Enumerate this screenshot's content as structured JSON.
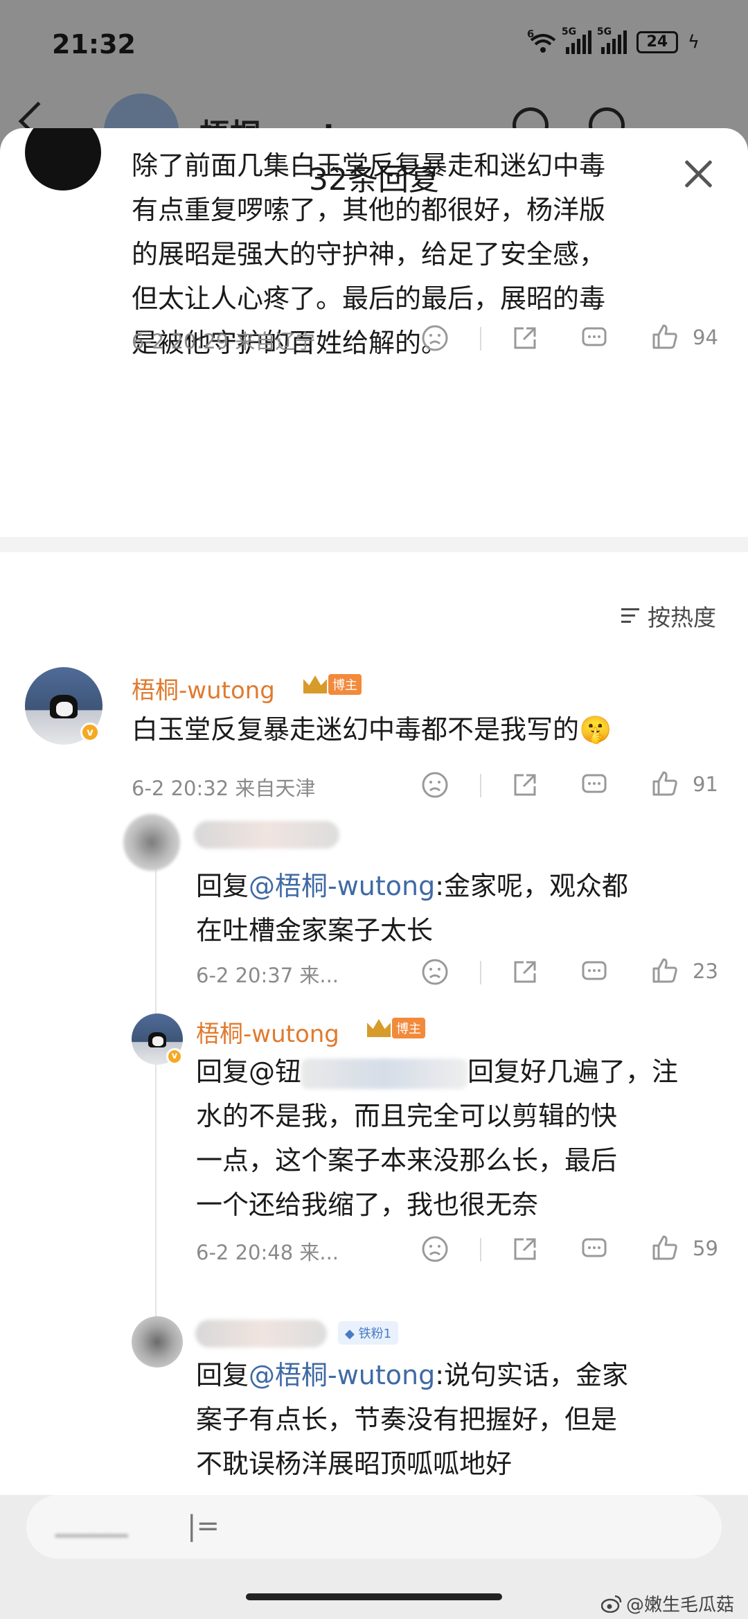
{
  "status_bar": {
    "time": "21:32",
    "wifi_label": "6",
    "net1": "5G",
    "net2": "5G",
    "battery": "24"
  },
  "background_header": {
    "name": "梧桐-wutong"
  },
  "sheet": {
    "title": "32条回复"
  },
  "root_comment": {
    "text": "除了前面几集白玉堂反复暴走和迷幻中毒\n有点重复啰嗦了，其他的都很好，杨洋版\n的展昭是强大的守护神，给足了安全感，\n但太让人心疼了。最后的最后，展昭的毒\n是被他守护的百姓给解的。",
    "meta": "6-2 20:29 来自辽宁",
    "likes": "94"
  },
  "sort": {
    "label": "按热度"
  },
  "replies": [
    {
      "name": "梧桐-wutong",
      "badge": "博主",
      "text": "白玉堂反复暴走迷幻中毒都不是我写的🤫",
      "meta": "6-2 20:32 来自天津",
      "likes": "91"
    },
    {
      "reply_prefix": "回复",
      "mention": "@梧桐-wutong",
      "text_after": ":金家呢，观众都\n在吐槽金家案子太长",
      "meta": "6-2 20:37 来...",
      "likes": "23"
    },
    {
      "name": "梧桐-wutong",
      "badge": "博主",
      "reply_prefix": "回复@钮",
      "text_after": "回复好几遍了，注",
      "text_rest": "水的不是我，而且完全可以剪辑的快\n一点，这个案子本来没那么长，最后\n一个还给我缩了，我也很无奈",
      "meta": "6-2 20:48 来...",
      "likes": "59"
    },
    {
      "fan_badge": "铁粉1",
      "reply_prefix": "回复",
      "mention": "@梧桐-wutong",
      "text_after": ":说句实话，金家\n案子有点长，节奏没有把握好，但是\n不耽误杨洋展昭顶呱呱地好"
    }
  ],
  "watermark": "@嫩生毛瓜菇"
}
